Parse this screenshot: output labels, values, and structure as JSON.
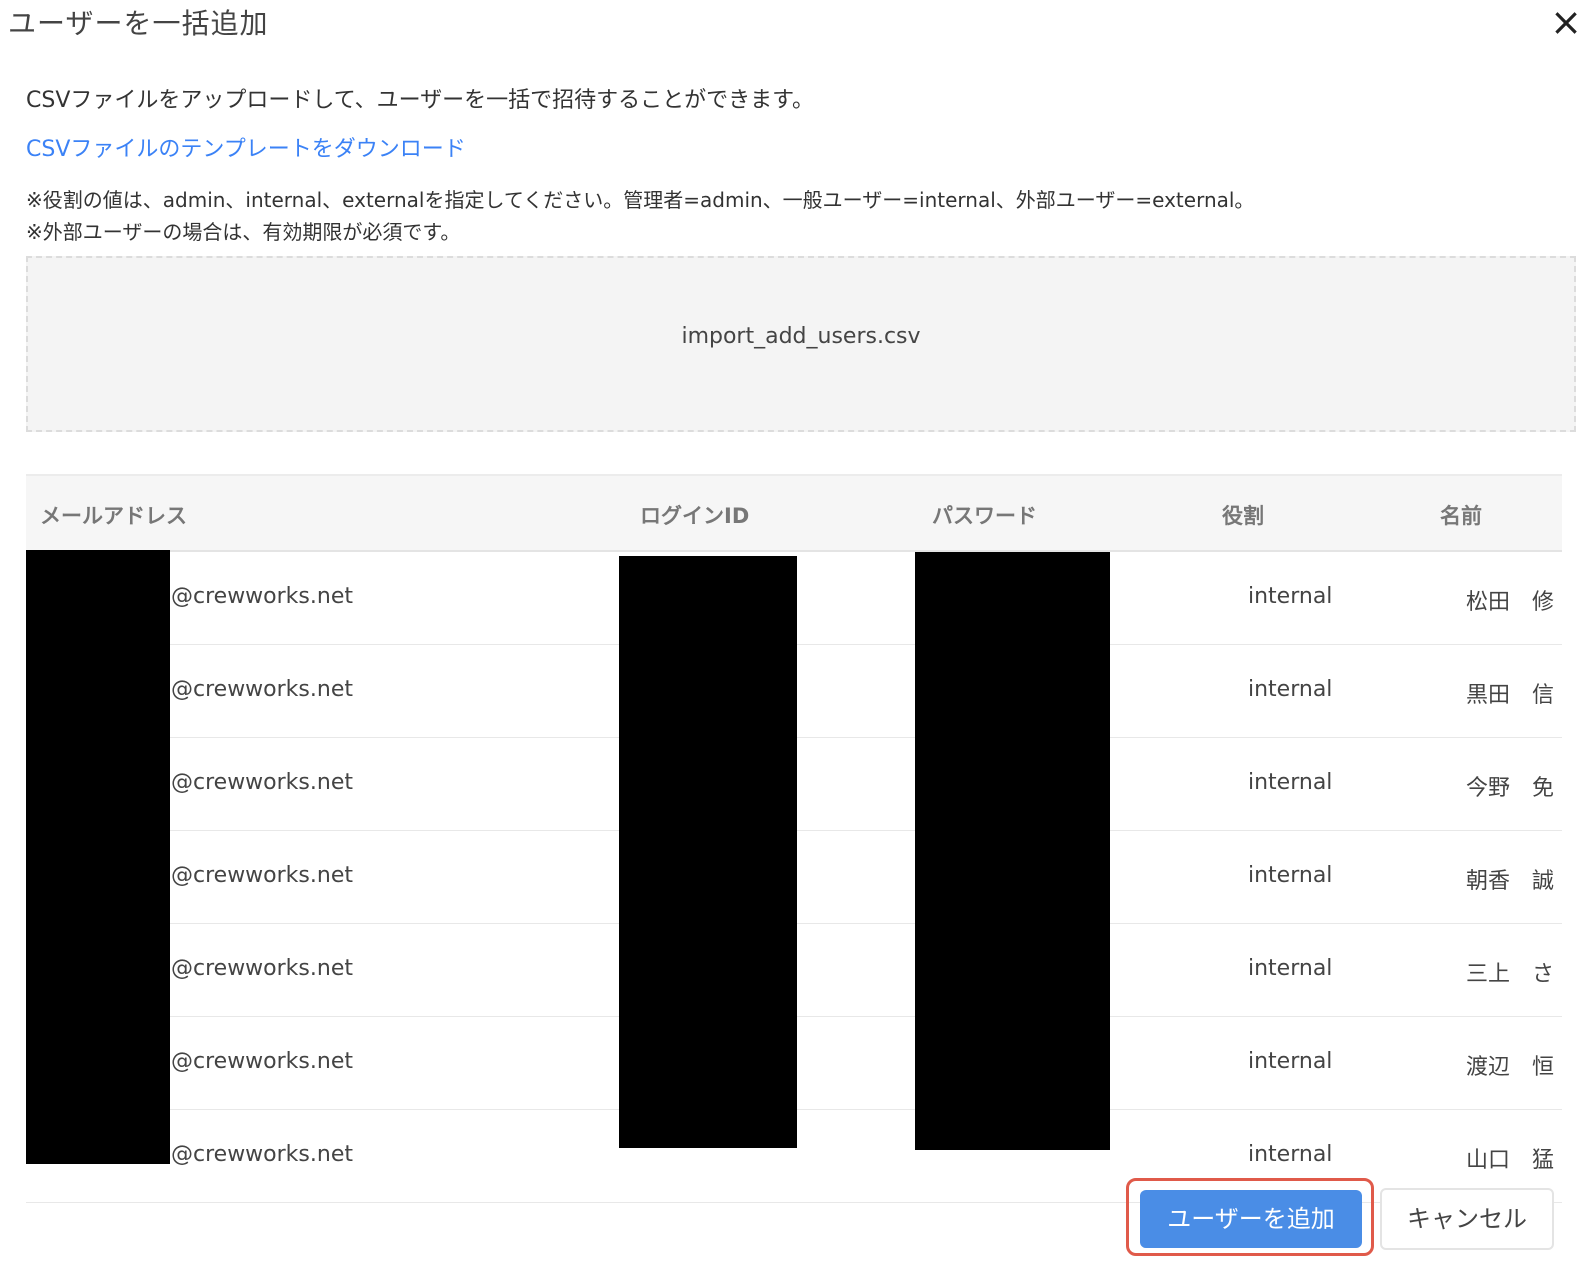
{
  "dialog": {
    "title": "ユーザーを一括追加",
    "close_icon": "×",
    "description": "CSVファイルをアップロードして、ユーザーを一括で招待することができます。",
    "template_link": "CSVファイルのテンプレートをダウンロード",
    "note1": "※役割の値は、admin、internal、externalを指定してください。管理者=admin、一般ユーザー=internal、外部ユーザー=external。",
    "note2": "※外部ユーザーの場合は、有効期限が必須です。",
    "file_name": "import_add_users.csv"
  },
  "table": {
    "headers": {
      "email": "メールアドレス",
      "login_id": "ログインID",
      "password": "パスワード",
      "role": "役割",
      "name": "名前"
    },
    "rows": [
      {
        "email": "@crewworks.net",
        "role": "internal",
        "name": "松田　修"
      },
      {
        "email": "@crewworks.net",
        "role": "internal",
        "name": "黒田　信"
      },
      {
        "email": "@crewworks.net",
        "role": "internal",
        "name": "今野　免"
      },
      {
        "email": "@crewworks.net",
        "role": "internal",
        "name": "朝香　誠"
      },
      {
        "email": "@crewworks.net",
        "role": "internal",
        "name": "三上　さ"
      },
      {
        "email": "@crewworks.net",
        "role": "internal",
        "name": "渡辺　恒"
      },
      {
        "email": "@crewworks.net",
        "role": "internal",
        "name": "山口　猛"
      }
    ]
  },
  "buttons": {
    "add": "ユーザーを追加",
    "cancel": "キャンセル"
  },
  "colors": {
    "primary": "#4a8de6",
    "highlight": "#e05a4a",
    "link": "#3b82f6"
  }
}
